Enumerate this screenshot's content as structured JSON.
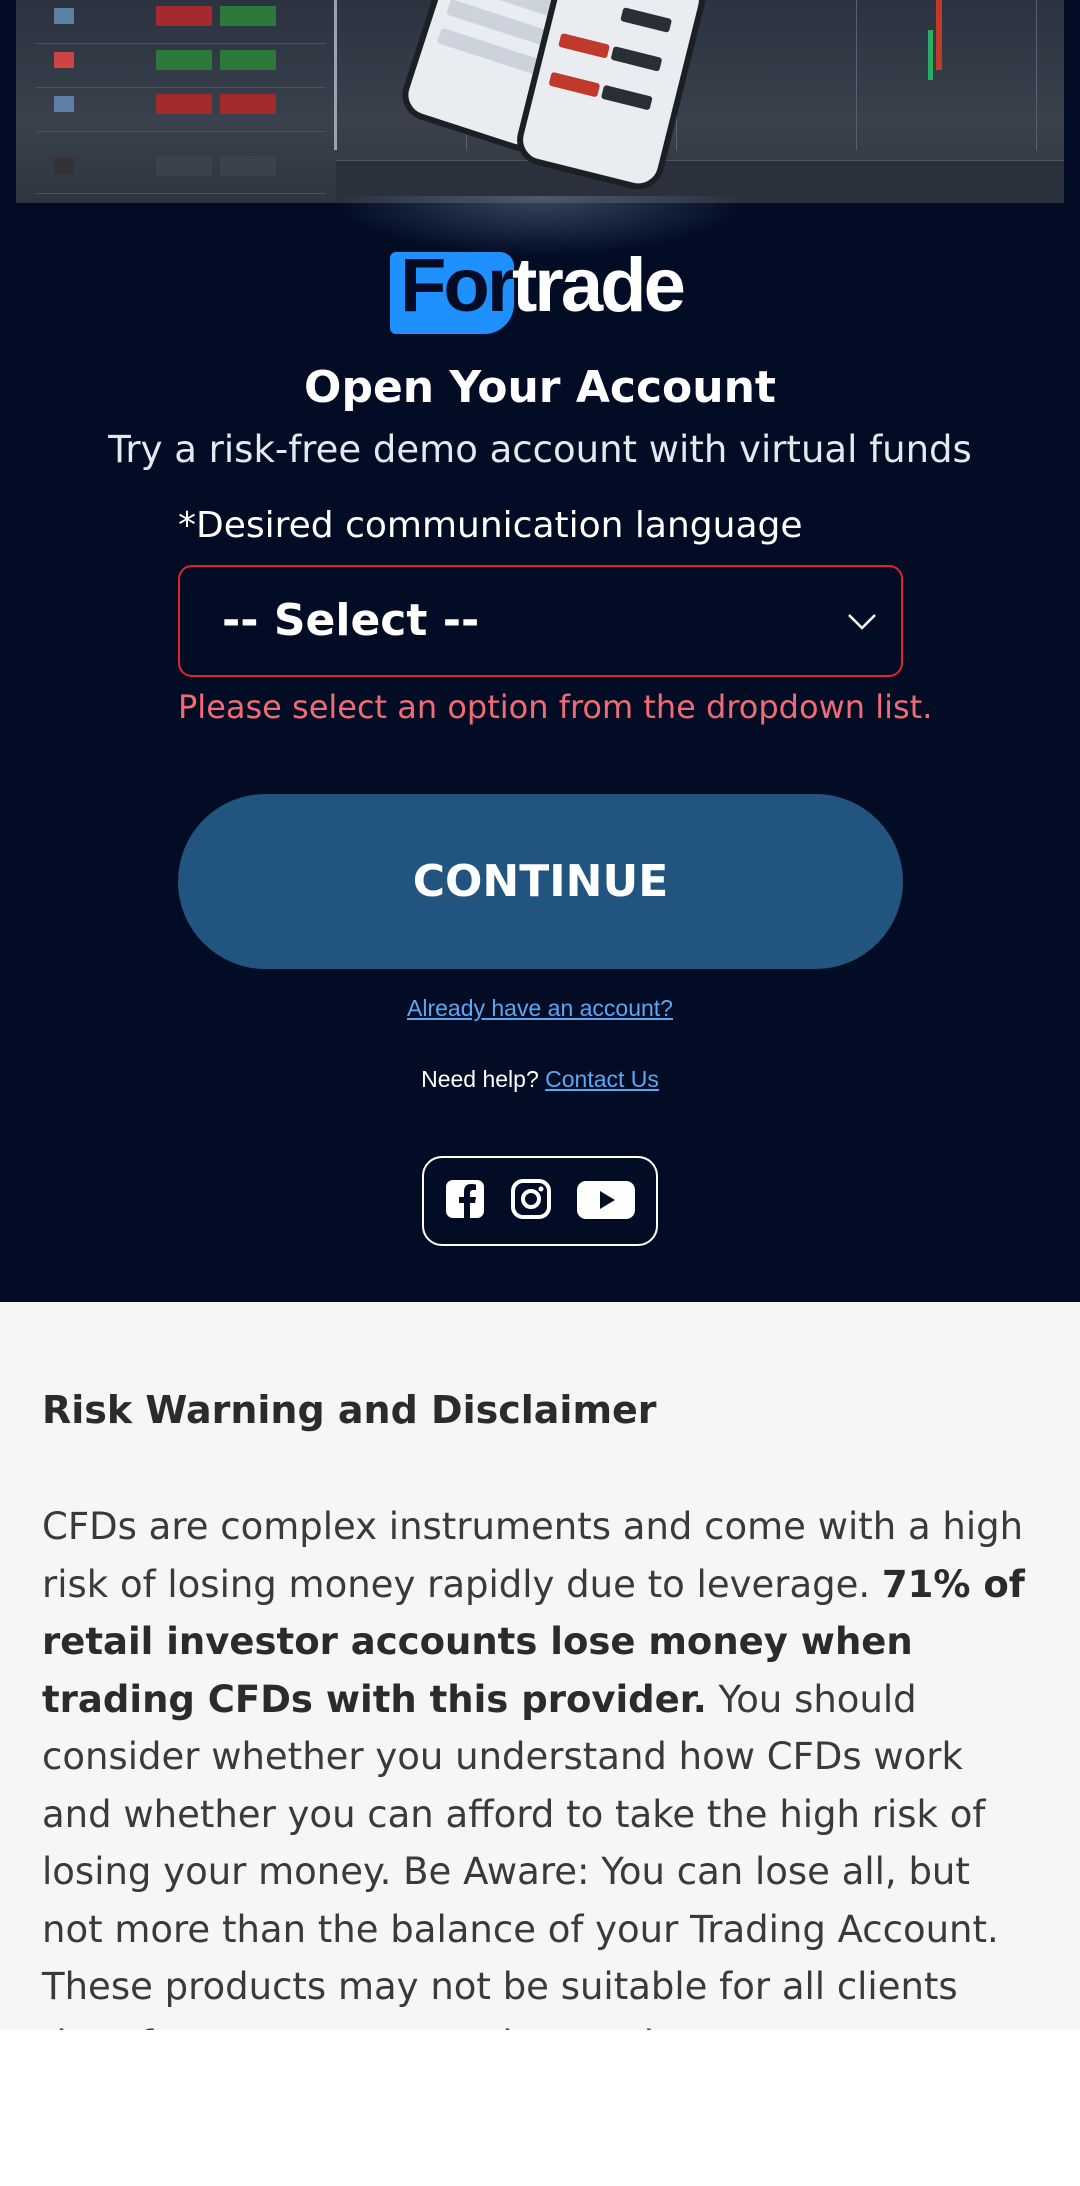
{
  "logo": {
    "brand_first": "For",
    "brand_rest": "trade"
  },
  "form": {
    "title": "Open Your Account",
    "subtitle": "Try a risk-free demo account with virtual funds",
    "language_label": "*Desired communication language",
    "select_value": "-- Select --",
    "error": "Please select an option from the dropdown list.",
    "continue_label": "CONTINUE",
    "login_link": "Already have an account?",
    "help_prefix": "Need help?",
    "help_link": "Contact Us"
  },
  "social": [
    "facebook-icon",
    "instagram-icon",
    "youtube-icon"
  ],
  "disclaimer": {
    "title": "Risk Warning and Disclaimer",
    "body_start": "CFDs are complex instruments and come with a high risk of losing money rapidly due to leverage. ",
    "body_bold": "71% of retail investor accounts lose money when trading CFDs with this provider.",
    "body_end": " You should consider whether you understand how CFDs work and whether you can afford to take the high risk of losing your money. Be Aware: You can lose all, but not more than the balance of your Trading Account. These products may not be suitable for all clients therefore ensure you understand"
  },
  "colors": {
    "background": "#020d25",
    "accent_blue": "#1e90ff",
    "button": "#21557f",
    "error": "#e0242f",
    "link": "#5aa8f5"
  }
}
